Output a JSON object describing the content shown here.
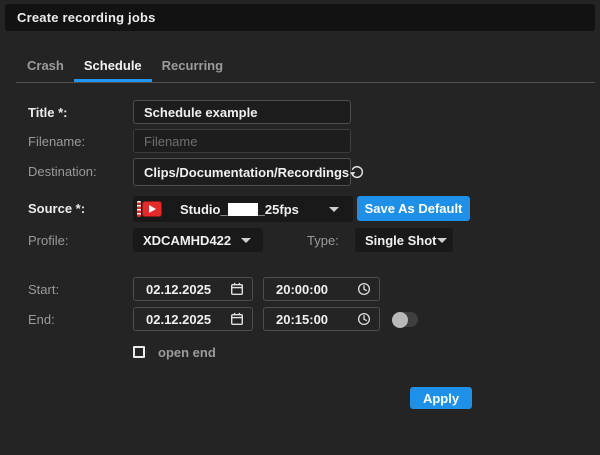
{
  "window": {
    "title": "Create recording jobs"
  },
  "tabs": [
    {
      "label": "Crash",
      "active": false
    },
    {
      "label": "Schedule",
      "active": true
    },
    {
      "label": "Recurring",
      "active": false
    }
  ],
  "form": {
    "title": {
      "label": "Title *:",
      "value": "Schedule example"
    },
    "filename": {
      "label": "Filename:",
      "placeholder": "Filename"
    },
    "destination": {
      "label": "Destination:",
      "value": "Clips/Documentation/Recordings",
      "icon": "restore-default-icon"
    },
    "source": {
      "label": "Source *:",
      "value_prefix": "Studio_",
      "value_suffix": "_25fps",
      "redacted": true,
      "icon": "video-source-icon"
    },
    "save_as_default_label": "Save As Default",
    "profile": {
      "label": "Profile:",
      "value": "XDCAMHD422"
    },
    "type": {
      "label": "Type:",
      "value": "Single Shot"
    },
    "start": {
      "label": "Start:",
      "date": "02.12.2025",
      "time": "20:00:00"
    },
    "end": {
      "label": "End:",
      "date": "02.12.2025",
      "time": "20:15:00",
      "toggle_on": false
    },
    "open_end": {
      "label": "open end",
      "checked": false
    },
    "apply_label": "Apply"
  },
  "colors": {
    "accent_blue": "#1e90e8",
    "tab_underline_blue": "#2196f3",
    "panel_bg": "#242424",
    "header_bg": "#121212",
    "field_bg": "#1d1d1d",
    "source_icon_red": "#e22b2b"
  }
}
